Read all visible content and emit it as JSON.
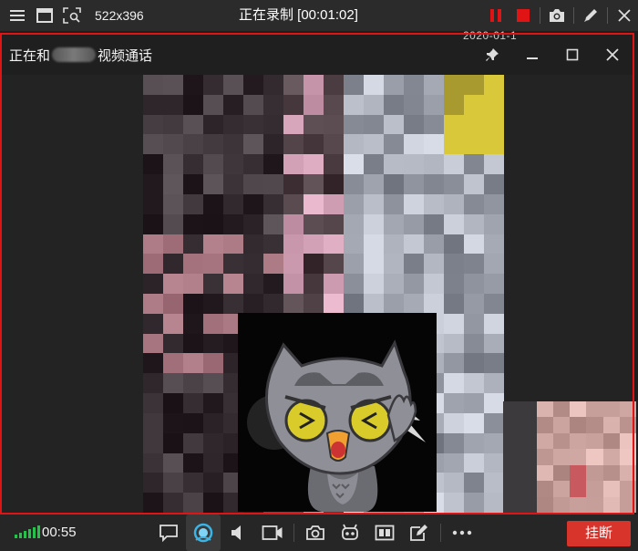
{
  "recorder": {
    "size_text": "522x396",
    "status_text": "正在录制 [00:01:02]",
    "icons": [
      "menu-icon",
      "window-icon",
      "region-zoom-icon",
      "pause-icon",
      "stop-icon",
      "camera-icon",
      "pen-icon",
      "close-icon"
    ],
    "accent_color": "#e01414"
  },
  "call_window": {
    "title_prefix": "正在和",
    "title_suffix": "视频通话",
    "behind_date": "2020-01-1",
    "controls": [
      "pin-icon",
      "minimize-icon",
      "maximize-icon",
      "close-icon"
    ]
  },
  "call_bar": {
    "duration": "00:55",
    "hangup_label": "挂断",
    "hangup_color": "#d8342b",
    "signal_color": "#27c24c",
    "tools": [
      "message-icon",
      "beauty-icon",
      "speaker-icon",
      "video-camera-icon",
      "screenshot-icon",
      "robot-icon",
      "layout-icon",
      "edit-icon",
      "more-icon"
    ]
  }
}
